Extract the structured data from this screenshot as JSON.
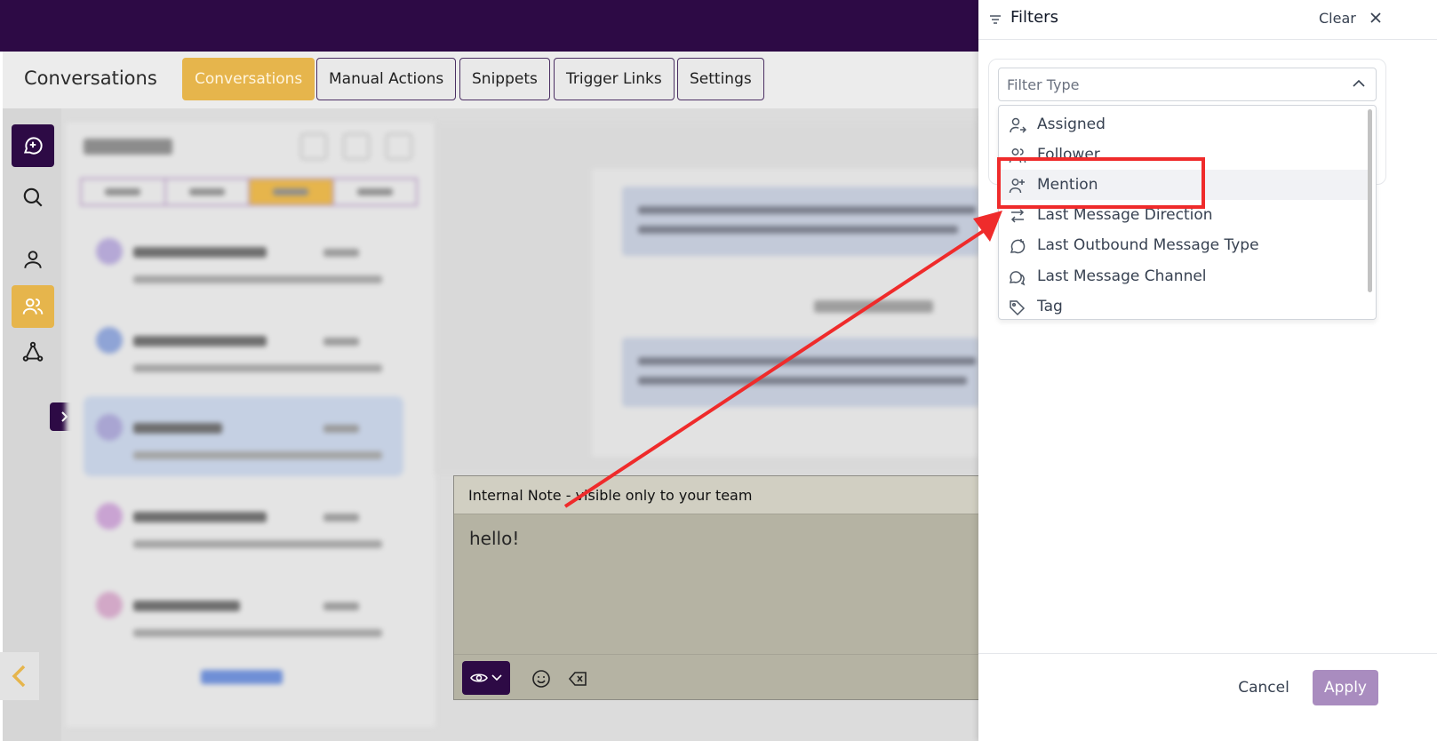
{
  "app": {
    "title": "Conversations",
    "tabs": [
      {
        "label": "Conversations",
        "active": true
      },
      {
        "label": "Manual Actions",
        "active": false
      },
      {
        "label": "Snippets",
        "active": false
      },
      {
        "label": "Trigger Links",
        "active": false
      },
      {
        "label": "Settings",
        "active": false
      }
    ],
    "sidebar_icons": [
      "new-conversation-icon",
      "search-icon",
      "contact-icon",
      "team-icon",
      "workflow-icon"
    ],
    "colors": {
      "brand_purple": "#2d0a45",
      "accent_gold": "#e6b54c",
      "annotation_red": "#ef2b2b"
    }
  },
  "composer": {
    "header": "Internal Note - visible only to your team",
    "text": "hello!"
  },
  "filters": {
    "title": "Filters",
    "clear_label": "Clear",
    "select_placeholder": "Filter Type",
    "options": [
      {
        "label": "Assigned",
        "icon": "user-assign-icon"
      },
      {
        "label": "Follower",
        "icon": "users-icon"
      },
      {
        "label": "Mention",
        "icon": "user-mention-icon",
        "highlighted": true
      },
      {
        "label": "Last Message Direction",
        "icon": "arrows-exchange-icon"
      },
      {
        "label": "Last Outbound Message Type",
        "icon": "message-refresh-icon"
      },
      {
        "label": "Last Message Channel",
        "icon": "chat-bubbles-icon"
      },
      {
        "label": "Tag",
        "icon": "tag-icon"
      }
    ],
    "cancel_label": "Cancel",
    "apply_label": "Apply"
  }
}
